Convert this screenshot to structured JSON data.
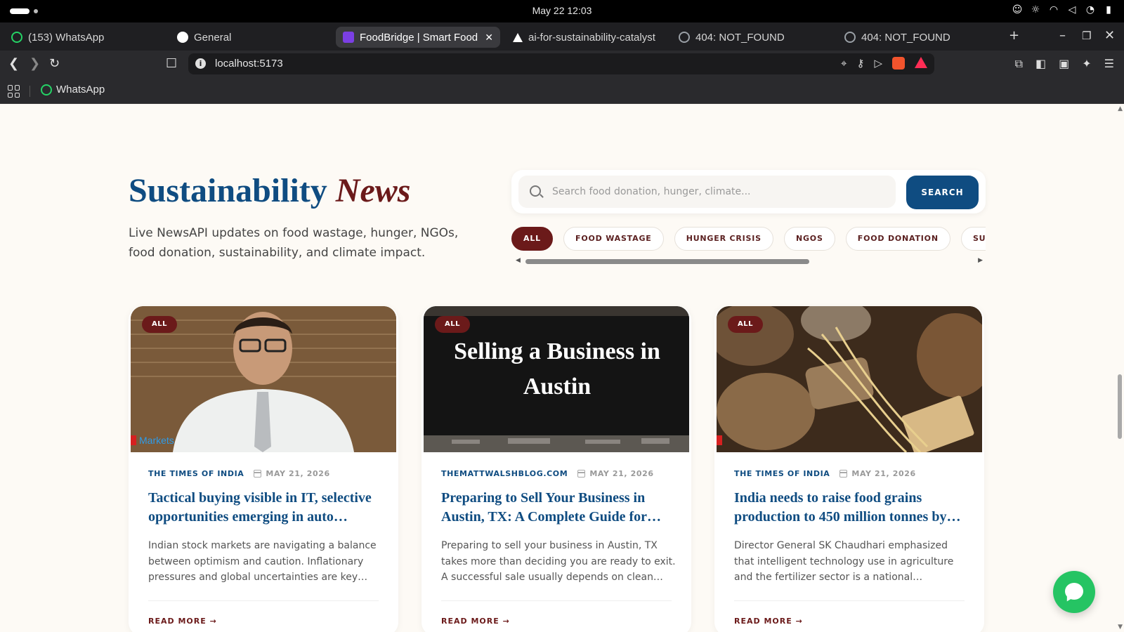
{
  "os": {
    "clock": "May 22  12:03"
  },
  "tabs": [
    {
      "label": "(153) WhatsApp",
      "favicon_color": "#25d366"
    },
    {
      "label": "General",
      "favicon_color": "#ffffff"
    },
    {
      "label": "FoodBridge | Smart Food",
      "favicon_color": "#7b3fe4",
      "active": true
    },
    {
      "label": "ai-for-sustainability-catalyst",
      "favicon_color": "#ffffff"
    },
    {
      "label": "404: NOT_FOUND",
      "favicon_color": "#9aa0a6"
    },
    {
      "label": "404: NOT_FOUND",
      "favicon_color": "#9aa0a6"
    }
  ],
  "address": {
    "url": "localhost:5173"
  },
  "bookmarks": [
    {
      "label": "WhatsApp"
    }
  ],
  "hero": {
    "title_main": "Sustainability",
    "title_accent": "News",
    "subtitle": "Live NewsAPI updates on food wastage, hunger, NGOs, food donation, sustainability, and climate impact."
  },
  "search": {
    "placeholder": "Search food donation, hunger, climate...",
    "value": "",
    "button_label": "SEARCH"
  },
  "filters": [
    {
      "label": "ALL",
      "active": true
    },
    {
      "label": "FOOD WASTAGE"
    },
    {
      "label": "HUNGER CRISIS"
    },
    {
      "label": "NGOS"
    },
    {
      "label": "FOOD DONATION"
    },
    {
      "label": "SUSTAINABILITY"
    }
  ],
  "articles": [
    {
      "tag": "ALL",
      "source": "THE TIMES OF INDIA",
      "date": "MAY 21, 2026",
      "title": "Tactical buying visible in IT, selective opportunities emerging in auto…",
      "description": "Indian stock markets are navigating a balance between optimism and caution. Inflationary pressures and global uncertainties are key…",
      "read_more": "READ MORE",
      "image_watermark": "Markets"
    },
    {
      "tag": "ALL",
      "source": "THEMATTWALSHBLOG.COM",
      "date": "MAY 21, 2026",
      "title": "Preparing to Sell Your Business in Austin, TX: A Complete Guide for…",
      "description": "Preparing to sell your business in Austin, TX takes more than deciding you are ready to exit. A successful sale usually depends on clean…",
      "read_more": "READ MORE",
      "image_caption": "Selling a Business in Austin"
    },
    {
      "tag": "ALL",
      "source": "THE TIMES OF INDIA",
      "date": "MAY 21, 2026",
      "title": "India needs to raise food grains production to 450 million tonnes by…",
      "description": "Director General SK Chaudhari emphasized that intelligent technology use in agriculture and the fertilizer sector is a national…",
      "read_more": "READ MORE"
    }
  ],
  "colors": {
    "primary": "#0f4c81",
    "accent": "#6b1a1a",
    "chat": "#25c463"
  }
}
